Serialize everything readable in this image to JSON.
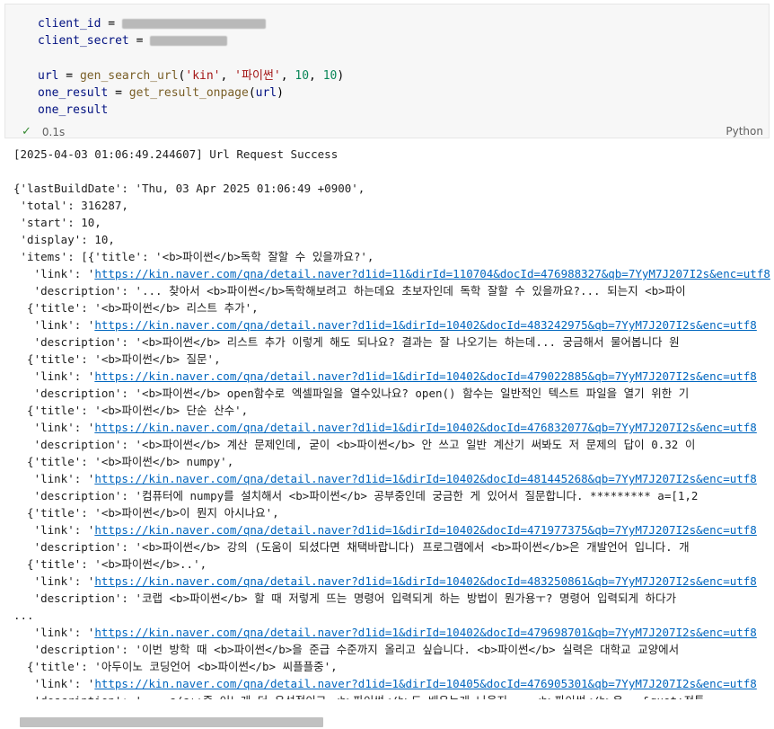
{
  "cell": {
    "code_lines": [
      {
        "var": "client_id",
        "op": " = ",
        "redacted": true
      },
      {
        "var": "client_secret",
        "op": " = ",
        "redacted": true
      },
      {
        "blank": true
      },
      {
        "var": "url",
        "op": " = ",
        "fn": "gen_search_url",
        "args": [
          "'kin'",
          "'파이썬'",
          "10",
          "10"
        ]
      },
      {
        "var": "one_result",
        "op": " = ",
        "fn": "get_result_onpage",
        "args_text": "url"
      },
      {
        "var": "one_result"
      }
    ],
    "exec_time": "0.1s",
    "language": "Python"
  },
  "output": {
    "lines": [
      {
        "text": "[2025-04-03 01:06:49.244607] Url Request Success"
      },
      {
        "text": ""
      },
      {
        "text": "{'lastBuildDate': 'Thu, 03 Apr 2025 01:06:49 +0900',"
      },
      {
        "text": " 'total': 316287,"
      },
      {
        "text": " 'start': 10,"
      },
      {
        "text": " 'display': 10,"
      },
      {
        "text": " 'items': [{'title': '<b>파이썬</b>독학 잘할 수 있을까요?',"
      },
      {
        "pre": "   'link': '",
        "link": "https://kin.naver.com/qna/detail.naver?d1id=11&dirId=110704&docId=476988327&qb=7YyM7J207I2s&enc=utf8"
      },
      {
        "text": "   'description': '... 찾아서 <b>파이썬</b>독학해보려고 하는데요 초보자인데 독학 잘할 수 있을까요?... 되는지 <b>파이"
      },
      {
        "text": "  {'title': '<b>파이썬</b> 리스트 추가',"
      },
      {
        "pre": "   'link': '",
        "link": "https://kin.naver.com/qna/detail.naver?d1id=1&dirId=10402&docId=483242975&qb=7YyM7J207I2s&enc=utf8"
      },
      {
        "text": "   'description': '<b>파이썬</b> 리스트 추가 이렇게 해도 되나요? 결과는 잘 나오기는 하는데... 궁금해서 물어봅니다 원"
      },
      {
        "text": "  {'title': '<b>파이썬</b> 질문',"
      },
      {
        "pre": "   'link': '",
        "link": "https://kin.naver.com/qna/detail.naver?d1id=1&dirId=10402&docId=479022885&qb=7YyM7J207I2s&enc=utf8"
      },
      {
        "text": "   'description': '<b>파이썬</b> open함수로 엑셀파일을 열수있나요? open() 함수는 일반적인 텍스트 파일을 열기 위한 기"
      },
      {
        "text": "  {'title': '<b>파이썬</b> 단순 산수',"
      },
      {
        "pre": "   'link': '",
        "link": "https://kin.naver.com/qna/detail.naver?d1id=1&dirId=10402&docId=476832077&qb=7YyM7J207I2s&enc=utf8"
      },
      {
        "text": "   'description': '<b>파이썬</b> 계산 문제인데, 굳이 <b>파이썬</b> 안 쓰고 일반 계산기 써봐도 저 문제의 답이 0.32 이"
      },
      {
        "text": "  {'title': '<b>파이썬</b> numpy',"
      },
      {
        "pre": "   'link': '",
        "link": "https://kin.naver.com/qna/detail.naver?d1id=1&dirId=10402&docId=481445268&qb=7YyM7J207I2s&enc=utf8"
      },
      {
        "text": "   'description': '컴퓨터에 numpy를 설치해서 <b>파이썬</b> 공부중인데 궁금한 게 있어서 질문합니다. ********* a=[1,2"
      },
      {
        "text": "  {'title': '<b>파이썬</b>이 뭔지 아시나요',"
      },
      {
        "pre": "   'link': '",
        "link": "https://kin.naver.com/qna/detail.naver?d1id=1&dirId=10402&docId=471977375&qb=7YyM7J207I2s&enc=utf8"
      },
      {
        "text": "   'description': '<b>파이썬</b> 강의 (도움이 되셨다면 채택바랍니다) 프로그램에서 <b>파이썬</b>은 개발언어 입니다. 개"
      },
      {
        "text": "  {'title': '<b>파이썬</b>..',"
      },
      {
        "pre": "   'link': '",
        "link": "https://kin.naver.com/qna/detail.naver?d1id=1&dirId=10402&docId=483250861&qb=7YyM7J207I2s&enc=utf8"
      },
      {
        "text": "   'description': '코랩 <b>파이썬</b> 할 때 저렇게 뜨는 명령어 입력되게 하는 방법이 뭔가용ㅜ? 명령어 입력되게 하다가"
      },
      {
        "text": "..."
      },
      {
        "pre": "   'link': '",
        "link": "https://kin.naver.com/qna/detail.naver?d1id=1&dirId=10402&docId=479698701&qb=7YyM7J207I2s&enc=utf8"
      },
      {
        "text": "   'description': '이번 방학 때 <b>파이썬</b>을 준급 수준까지 올리고 싶습니다. <b>파이썬</b> 실력은 대학교 교양에서"
      },
      {
        "text": "  {'title': '아두이노 코딩언어 <b>파이썬</b> 씨플플중',"
      },
      {
        "pre": "   'link': '",
        "link": "https://kin.naver.com/qna/detail.naver?d1id=1&dirId=10405&docId=476905301&qb=7YyM7J207I2s&enc=utf8"
      },
      {
        "text": "   'description': '... c/c++중 어느게 더 우선적이고 <b>파이썬</b>도 배우는게 나을지... <b>파이썬</b>은.. &quot;전통"
      }
    ]
  }
}
